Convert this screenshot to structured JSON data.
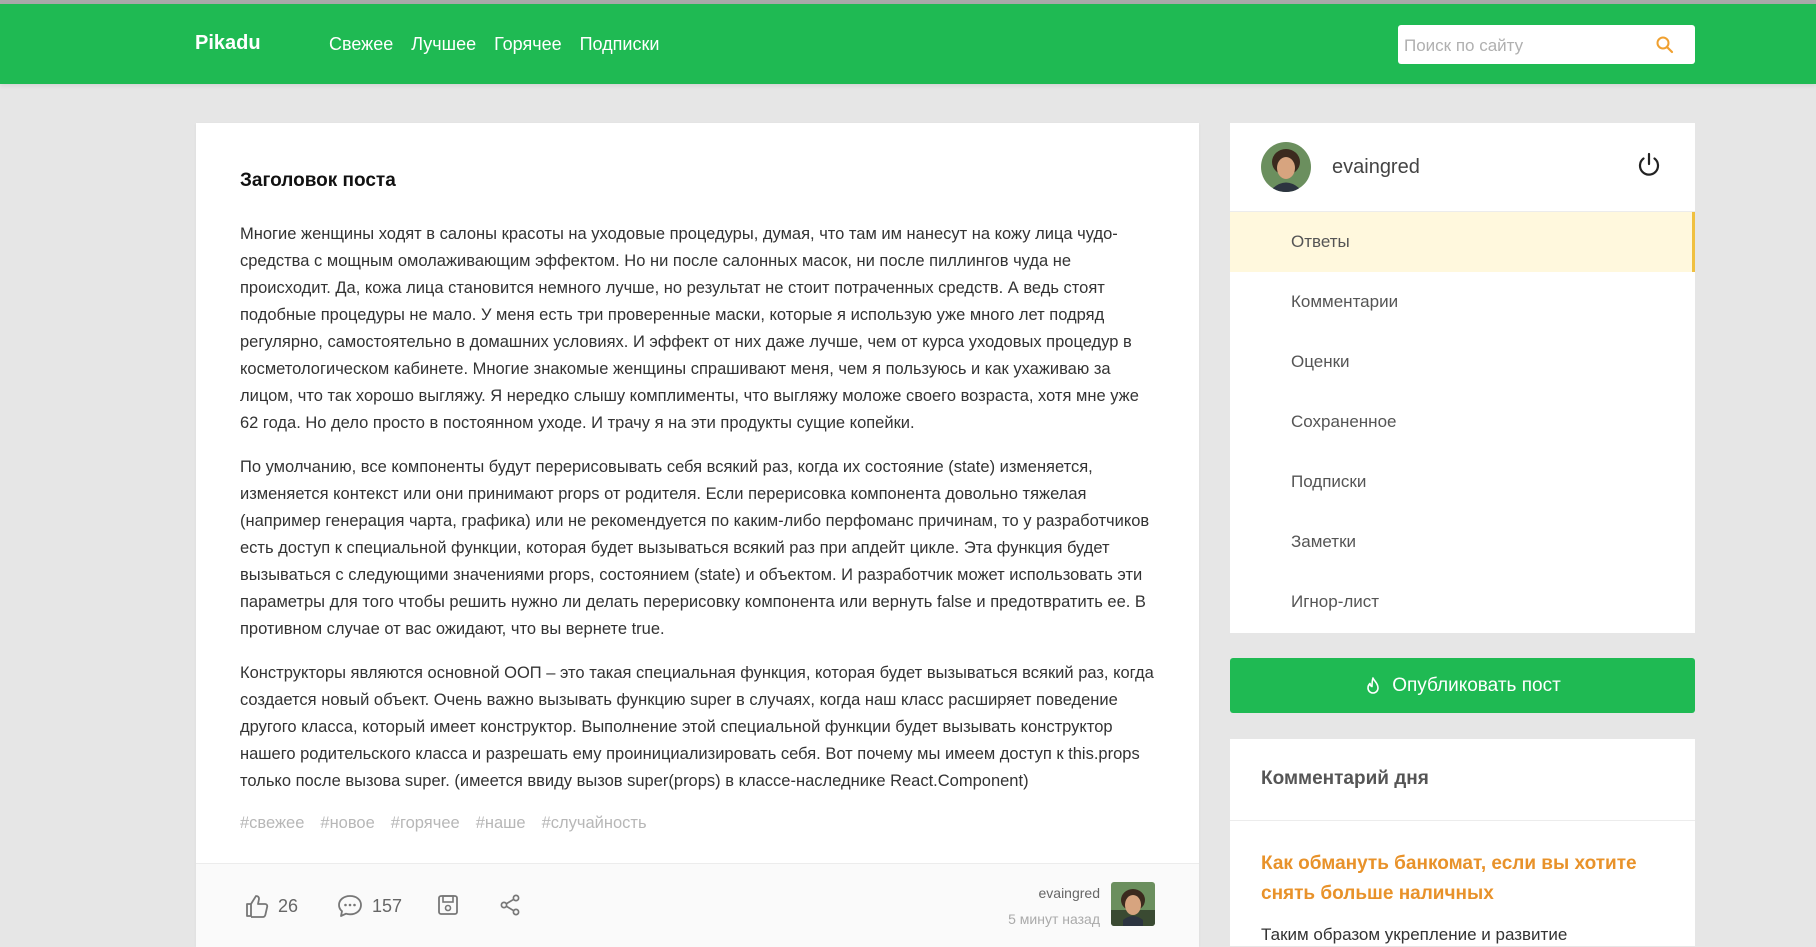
{
  "header": {
    "logo": "Pikadu",
    "nav": [
      "Свежее",
      "Лучшее",
      "Горячее",
      "Подписки"
    ],
    "search_placeholder": "Поиск по сайту"
  },
  "post": {
    "title": "Заголовок поста",
    "paragraphs": [
      "Многие женщины ходят в салоны красоты на уходовые процедуры, думая, что там им нанесут на кожу лица чудо-средства с мощным омолаживающим эффектом. Но ни после салонных масок, ни после пиллингов чуда не происходит. Да, кожа лица становится немного лучше, но результат не стоит потраченных средств. А ведь стоят подобные процедуры не мало. У меня есть три проверенные маски, которые я использую уже много лет подряд регулярно, самостоятельно в домашних условиях. И эффект от них даже лучше, чем от курса уходовых процедур в косметологическом кабинете. Многие знакомые женщины спрашивают меня, чем я пользуюсь и как ухаживаю за лицом, что так хорошо выгляжу. Я нередко слышу комплименты, что выгляжу моложе своего возраста, хотя мне уже 62 года. Но дело просто в постоянном уходе. И трачу я на эти продукты сущие копейки.",
      "По умолчанию, все компоненты будут перерисовывать себя всякий раз, когда их состояние (state) изменяется, изменяется контекст или они принимают props от родителя. Если перерисовка компонента довольно тяжелая (например генерация чарта, графика) или не рекомендуется по каким-либо перфоманс причинам, то у разработчиков есть доступ к специальной функции, которая будет вызываться всякий раз при апдейт цикле. Эта функция будет вызываться с следующими значениями props, состоянием (state) и объектом. И разработчик может использовать эти параметры для того чтобы решить нужно ли делать перерисовку компонента или вернуть false и предотвратить ее. В противном случае от вас ожидают, что вы вернете true.",
      "Конструкторы являются основной ООП – это такая специальная функция, которая будет вызываться всякий раз, когда создается новый объект. Очень важно вызывать функцию super в случаях, когда наш класс расширяет поведение другого класса, который имеет конструктор. Выполнение этой специальной функции будет вызывать конструктор нашего родительского класса и разрешать ему проинициализировать себя. Вот почему мы имеем доступ к this.props только после вызова super. (имеется ввиду вызов super(props) в классе-наследнике React.Component)"
    ],
    "tags": [
      "#свежее",
      "#новое",
      "#горячее",
      "#наше",
      "#случайность"
    ],
    "likes": "26",
    "comments": "157",
    "author": "evaingred",
    "time": "5 минут назад"
  },
  "profile": {
    "username": "evaingred",
    "menu": [
      "Ответы",
      "Комментарии",
      "Оценки",
      "Сохраненное",
      "Подписки",
      "Заметки",
      "Игнор-лист"
    ],
    "active_index": 0
  },
  "publish_label": "Опубликовать пост",
  "comment_of_day": {
    "title": "Комментарий дня",
    "link": "Как обмануть банкомат, если вы хотите снять больше наличных",
    "text": "Таким образом укрепление и развитие"
  },
  "colors": {
    "brand_green": "#1fba53",
    "accent_orange": "#e8922a",
    "active_menu_bg": "#fff8dd"
  }
}
